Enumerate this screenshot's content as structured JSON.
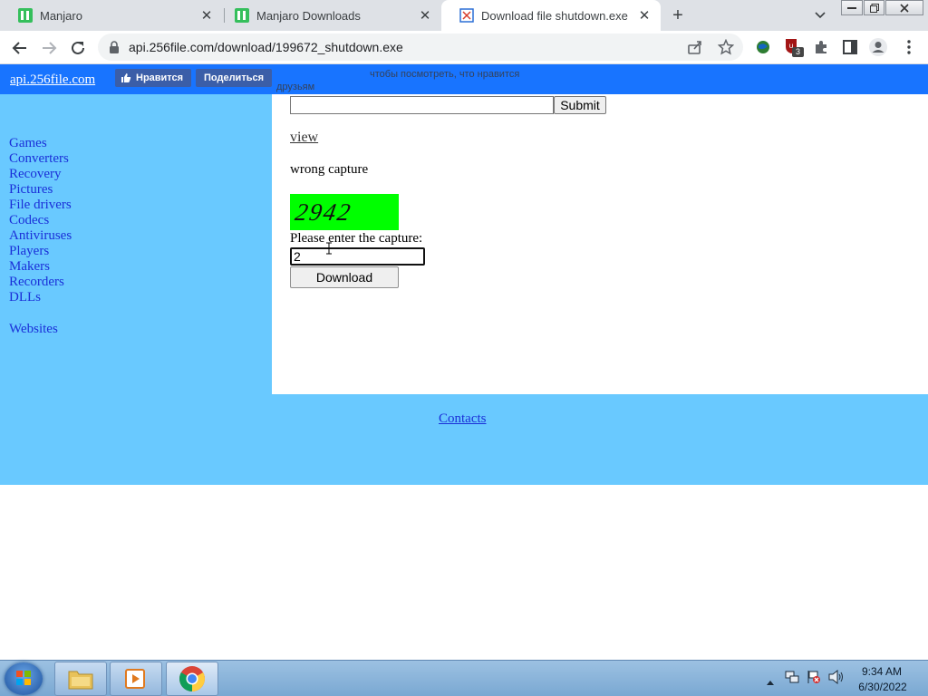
{
  "browser": {
    "tabs": [
      {
        "title": "Manjaro",
        "icon": "manjaro-icon"
      },
      {
        "title": "Manjaro Downloads",
        "icon": "manjaro-icon"
      },
      {
        "title": "Download file shutdown.exe",
        "icon": "site-favicon",
        "active": true
      }
    ],
    "new_tab_label": "+",
    "close_glyph": "✕",
    "url": "api.256file.com/download/199672_shutdown.exe",
    "extension_badge": "3"
  },
  "header": {
    "site_link": "api.256file.com",
    "like_label": "Нравится",
    "share_label": "Поделиться",
    "fb_note_line1": "чтобы посмотреть, что нравится",
    "fb_note_line2": "друзьям"
  },
  "sidebar": {
    "items": [
      "Games",
      "Converters",
      "Recovery",
      "Pictures",
      "File drivers",
      "Codecs",
      "Antiviruses",
      "Players",
      "Makers",
      "Recorders",
      "DLLs"
    ],
    "extra_link": "Websites"
  },
  "main": {
    "search_value": "",
    "submit_label": "Submit",
    "view_link": "view",
    "error_text": "wrong capture",
    "captcha_text": "2942",
    "captcha_color": "#00ff00",
    "capture_label": "Please enter the capture:",
    "capture_value": "2",
    "download_label": "Download"
  },
  "footer": {
    "contacts_link": "Contacts"
  },
  "taskbar": {
    "time": "9:34 AM",
    "date": "6/30/2022"
  },
  "colors": {
    "header_bg": "#1874ff",
    "sidebar_bg": "#69c9ff",
    "link": "#1a2fd8"
  }
}
